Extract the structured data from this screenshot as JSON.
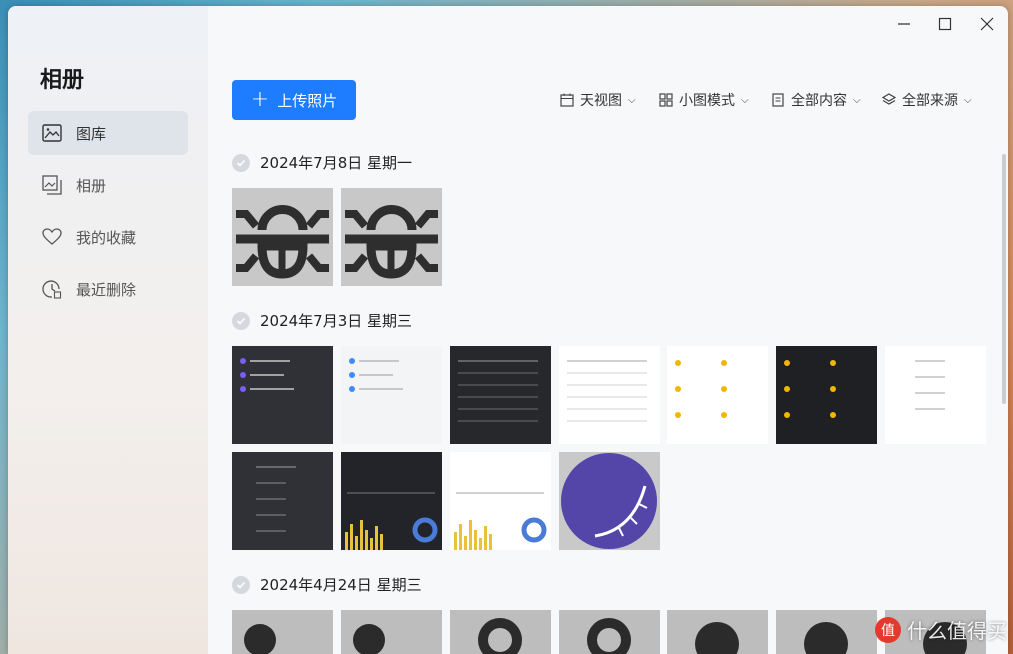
{
  "sidebar": {
    "title": "相册",
    "items": [
      {
        "label": "图库",
        "icon": "image-icon"
      },
      {
        "label": "相册",
        "icon": "album-icon"
      },
      {
        "label": "我的收藏",
        "icon": "heart-icon"
      },
      {
        "label": "最近删除",
        "icon": "recent-delete-icon"
      }
    ]
  },
  "toolbar": {
    "upload_label": "上传照片",
    "view_label": "天视图",
    "mode_label": "小图模式",
    "content_label": "全部内容",
    "source_label": "全部来源"
  },
  "groups": [
    {
      "date": "2024年7月8日 星期一",
      "photo_count": 2
    },
    {
      "date": "2024年7月3日 星期三",
      "photo_count": 11
    },
    {
      "date": "2024年4月24日 星期三",
      "photo_count": 7
    }
  ],
  "watermark": {
    "badge": "值",
    "text": "什么值得买"
  }
}
